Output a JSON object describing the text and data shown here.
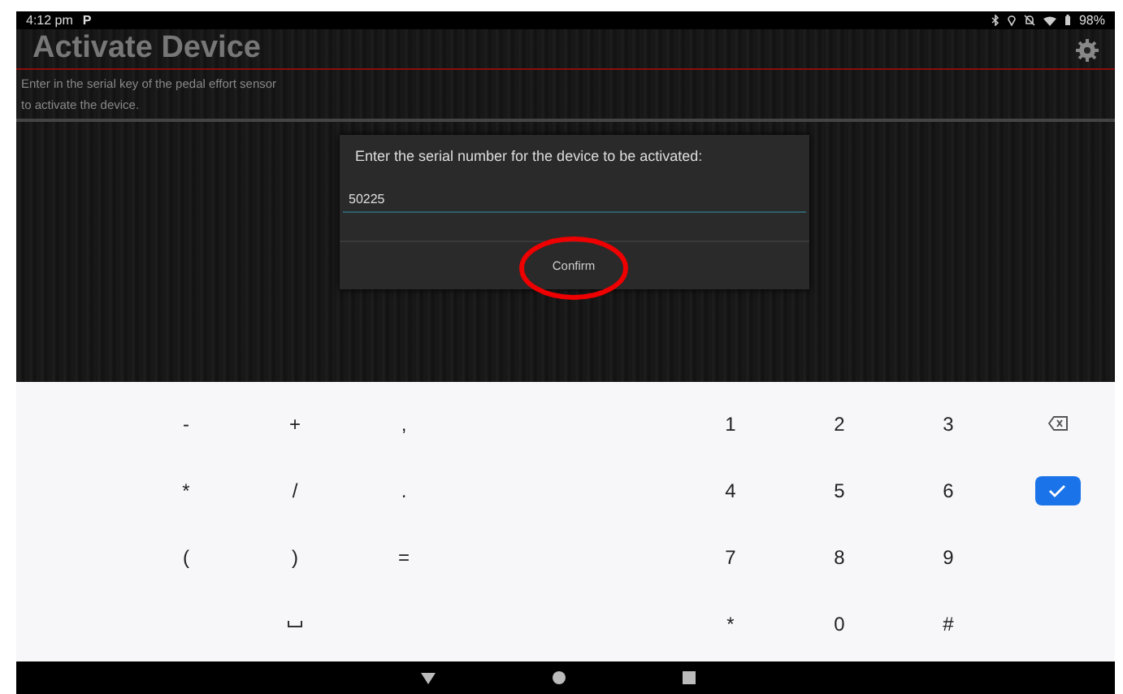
{
  "status_bar": {
    "time": "4:12 pm",
    "app_badge": "P",
    "battery": "98%"
  },
  "header": {
    "title": "Activate Device",
    "description_lines": [
      "Enter in the serial key of the pedal effort sensor",
      "to activate the device."
    ]
  },
  "dialog": {
    "prompt": "Enter the serial number for the device to be activated:",
    "value": "50225",
    "button": "Confirm"
  },
  "keyboard": {
    "rows": [
      [
        {
          "kind": "char",
          "label": "-"
        },
        {
          "kind": "char",
          "label": "+"
        },
        {
          "kind": "char",
          "label": ","
        },
        {
          "kind": "empty"
        },
        {
          "kind": "empty"
        },
        {
          "kind": "char",
          "label": "1"
        },
        {
          "kind": "char",
          "label": "2"
        },
        {
          "kind": "char",
          "label": "3"
        },
        {
          "kind": "backspace"
        }
      ],
      [
        {
          "kind": "char",
          "label": "*"
        },
        {
          "kind": "char",
          "label": "/"
        },
        {
          "kind": "char",
          "label": "."
        },
        {
          "kind": "empty"
        },
        {
          "kind": "empty"
        },
        {
          "kind": "char",
          "label": "4"
        },
        {
          "kind": "char",
          "label": "5"
        },
        {
          "kind": "char",
          "label": "6"
        },
        {
          "kind": "enter"
        }
      ],
      [
        {
          "kind": "char",
          "label": "("
        },
        {
          "kind": "char",
          "label": ")"
        },
        {
          "kind": "char",
          "label": "="
        },
        {
          "kind": "empty"
        },
        {
          "kind": "empty"
        },
        {
          "kind": "char",
          "label": "7"
        },
        {
          "kind": "char",
          "label": "8"
        },
        {
          "kind": "char",
          "label": "9"
        },
        {
          "kind": "empty"
        }
      ],
      [
        {
          "kind": "empty"
        },
        {
          "kind": "space"
        },
        {
          "kind": "empty"
        },
        {
          "kind": "empty"
        },
        {
          "kind": "empty"
        },
        {
          "kind": "char",
          "label": "*"
        },
        {
          "kind": "char",
          "label": "0"
        },
        {
          "kind": "char",
          "label": "#"
        },
        {
          "kind": "empty"
        }
      ]
    ]
  }
}
